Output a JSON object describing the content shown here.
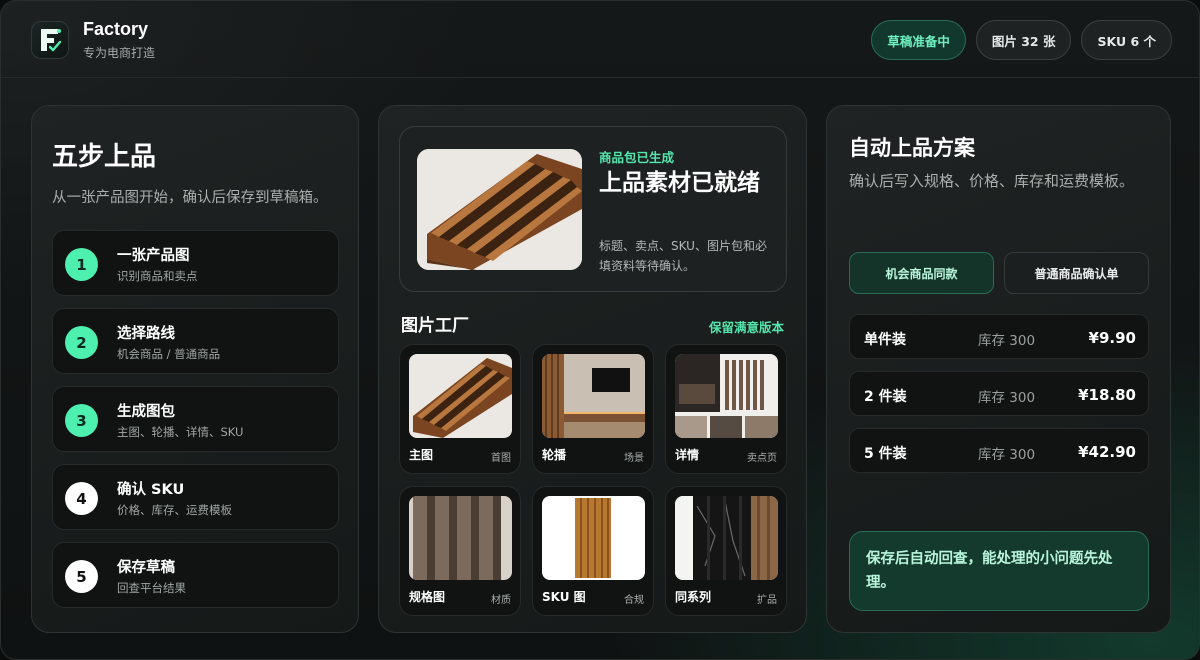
{
  "brand": {
    "name": "Factory",
    "subtitle": "专为电商打造",
    "logo": "factory-logo-icon"
  },
  "header": {
    "pills": [
      {
        "label": "草稿准备中",
        "accent": true
      },
      {
        "label": "图片 32 张",
        "accent": false
      },
      {
        "label": "SKU 6 个",
        "accent": false
      }
    ]
  },
  "steps_panel": {
    "title": "五步上品",
    "description": "从一张产品图开始，确认后保存到草稿箱。",
    "steps": [
      {
        "num": "1",
        "title": "一张产品图",
        "sub": "识别商品和卖点",
        "done": true
      },
      {
        "num": "2",
        "title": "选择路线",
        "sub": "机会商品 / 普通商品",
        "done": true
      },
      {
        "num": "3",
        "title": "生成图包",
        "sub": "主图、轮播、详情、SKU",
        "done": true
      },
      {
        "num": "4",
        "title": "确认 SKU",
        "sub": "价格、库存、运费模板",
        "done": false
      },
      {
        "num": "5",
        "title": "保存草稿",
        "sub": "回查平台结果",
        "done": false
      }
    ]
  },
  "package": {
    "tag": "商品包已生成",
    "title": "上品素材已就绪",
    "description": "标题、卖点、SKU、图片包和必填资料等待确认。"
  },
  "image_factory": {
    "title": "图片工厂",
    "link": "保留满意版本",
    "tiles": [
      {
        "name": "主图",
        "tag": "首图"
      },
      {
        "name": "轮播",
        "tag": "场景"
      },
      {
        "name": "详情",
        "tag": "卖点页"
      },
      {
        "name": "规格图",
        "tag": "材质"
      },
      {
        "name": "SKU 图",
        "tag": "合规"
      },
      {
        "name": "同系列",
        "tag": "扩品"
      }
    ]
  },
  "plan": {
    "title": "自动上品方案",
    "description": "确认后写入规格、价格、库存和运费模板。",
    "tabs": [
      {
        "label": "机会商品同款",
        "active": true
      },
      {
        "label": "普通商品确认单",
        "active": false
      }
    ],
    "skus": [
      {
        "name": "单件装",
        "stock": "库存 300",
        "price": "¥9.90"
      },
      {
        "name": "2 件装",
        "stock": "库存 300",
        "price": "¥18.80"
      },
      {
        "name": "5 件装",
        "stock": "库存 300",
        "price": "¥42.90"
      }
    ],
    "note": "保存后自动回查，能处理的小问题先处理。"
  },
  "colors": {
    "accent": "#4ef0b0",
    "accent_text": "#52e6ad",
    "accent_bg": "#143a2e",
    "background": "#0f1212"
  }
}
